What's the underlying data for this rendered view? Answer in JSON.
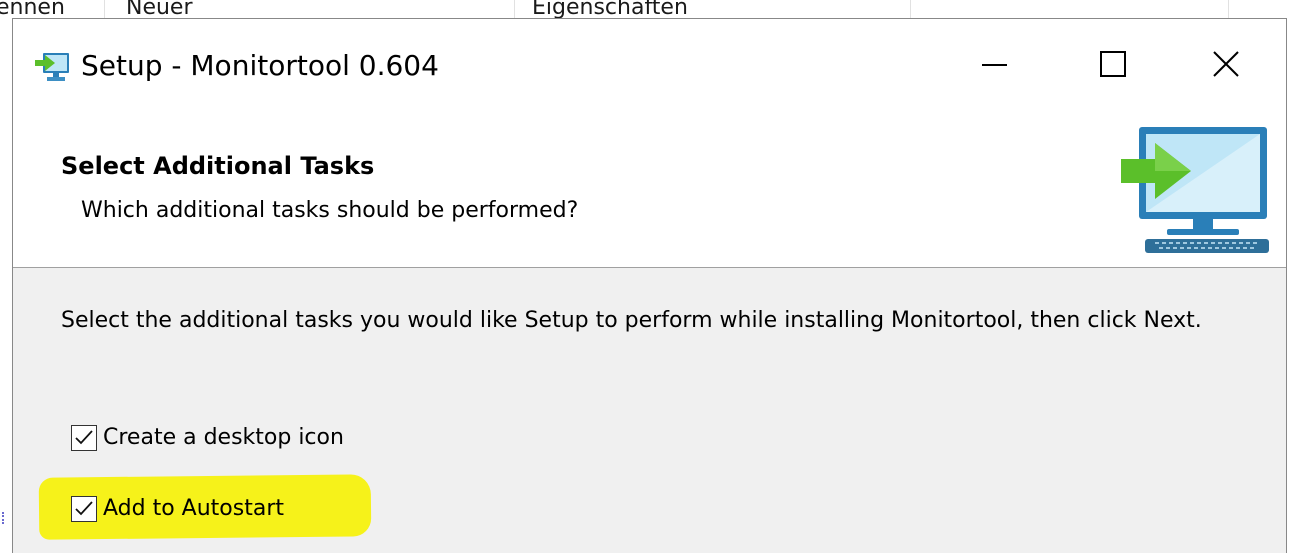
{
  "background": {
    "columns": [
      {
        "label": "ennen"
      },
      {
        "label": "Neuer"
      },
      {
        "label": "Eigenschaften"
      }
    ]
  },
  "window": {
    "title": "Setup - Monitortool 0.604",
    "icon": "setup-monitor-icon",
    "controls": {
      "minimize_icon": "minimize-icon",
      "maximize_icon": "maximize-icon",
      "close_icon": "close-icon"
    }
  },
  "header": {
    "title": "Select Additional Tasks",
    "subtitle": "Which additional tasks should be performed?",
    "icon": "monitor-install-arrow-icon"
  },
  "body": {
    "instruction": "Select the additional tasks you would like Setup to perform while installing Monitortool, then click Next.",
    "tasks": [
      {
        "label": "Create a desktop icon",
        "checked": true
      },
      {
        "label": "Add to Autostart",
        "checked": true,
        "highlighted": true
      }
    ]
  },
  "colors": {
    "highlight": "#f6f21a",
    "arrow_green": "#5bbf2a",
    "monitor_blue": "#2a7fb8",
    "screen_light": "#bfe6f7"
  }
}
